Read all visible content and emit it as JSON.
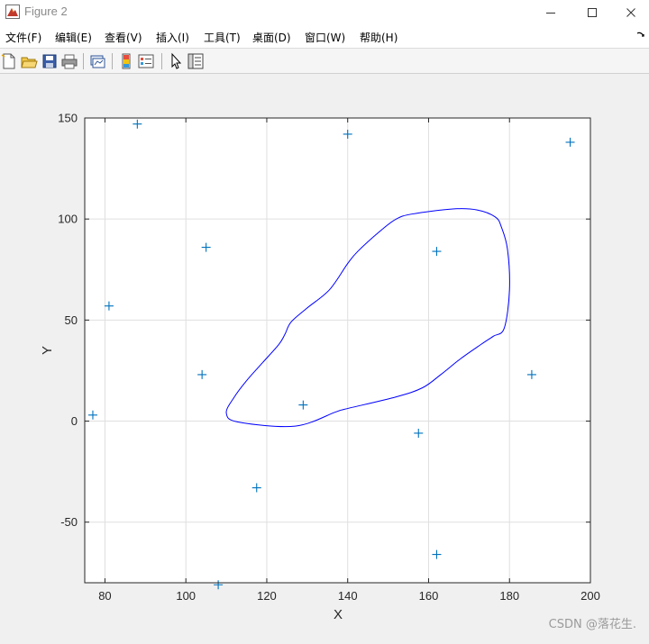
{
  "window": {
    "title": "Figure 2",
    "icon": "matlab-figure-icon"
  },
  "menu": {
    "items": [
      {
        "label": "文件(F)",
        "name": "menu-file"
      },
      {
        "label": "编辑(E)",
        "name": "menu-edit"
      },
      {
        "label": "查看(V)",
        "name": "menu-view"
      },
      {
        "label": "插入(I)",
        "name": "menu-insert"
      },
      {
        "label": "工具(T)",
        "name": "menu-tools"
      },
      {
        "label": "桌面(D)",
        "name": "menu-desktop"
      },
      {
        "label": "窗口(W)",
        "name": "menu-window"
      },
      {
        "label": "帮助(H)",
        "name": "menu-help"
      }
    ],
    "overflow_icon": "curved-arrow-icon"
  },
  "toolbar": {
    "icons": [
      "new-figure-icon",
      "open-file-icon",
      "save-icon",
      "print-icon",
      "link-plot-icon",
      "insert-colorbar-icon",
      "insert-legend-icon",
      "edit-plot-icon",
      "property-inspector-icon"
    ]
  },
  "watermark": "CSDN @落花生.",
  "colors": {
    "marker": "#0072bd",
    "curve": "#0000ff",
    "grid": "#dfdfdf",
    "figure_bg": "#f0f0f0"
  },
  "chart_data": {
    "type": "scatter",
    "xlabel": "X",
    "ylabel": "Y",
    "xlim": [
      75,
      200
    ],
    "ylim": [
      -80,
      150
    ],
    "xticks": [
      80,
      100,
      120,
      140,
      160,
      180,
      200
    ],
    "yticks": [
      -50,
      0,
      50,
      100,
      150
    ],
    "grid": true,
    "series": [
      {
        "kind": "markers",
        "marker": "+",
        "points": [
          [
            88,
            147
          ],
          [
            140,
            142
          ],
          [
            195,
            138
          ],
          [
            105,
            86
          ],
          [
            162,
            84
          ],
          [
            81,
            57
          ],
          [
            104,
            23
          ],
          [
            185.5,
            23
          ],
          [
            129,
            8
          ],
          [
            77,
            3
          ],
          [
            157.5,
            -6
          ],
          [
            117.5,
            -33
          ],
          [
            162,
            -66
          ],
          [
            108,
            -81
          ]
        ]
      },
      {
        "kind": "closed-curve",
        "points": [
          [
            135.5,
            65
          ],
          [
            140,
            78
          ],
          [
            142.5,
            84
          ],
          [
            148,
            94
          ],
          [
            152,
            100
          ],
          [
            156,
            102.5
          ],
          [
            166,
            105
          ],
          [
            172,
            104.5
          ],
          [
            176.5,
            101
          ],
          [
            178,
            96
          ],
          [
            179.5,
            85
          ],
          [
            180,
            65
          ],
          [
            178.7,
            46
          ],
          [
            176,
            42
          ],
          [
            173,
            38
          ],
          [
            168,
            31
          ],
          [
            163,
            23
          ],
          [
            158.5,
            16.5
          ],
          [
            152,
            12
          ],
          [
            139.5,
            6
          ],
          [
            137,
            4.5
          ],
          [
            127,
            -2.5
          ],
          [
            113,
            -0.5
          ],
          [
            110,
            4
          ],
          [
            112,
            12
          ],
          [
            115,
            20
          ],
          [
            119,
            29
          ],
          [
            123,
            38
          ],
          [
            124.5,
            43
          ],
          [
            126,
            49
          ],
          [
            130,
            56
          ]
        ]
      }
    ]
  }
}
